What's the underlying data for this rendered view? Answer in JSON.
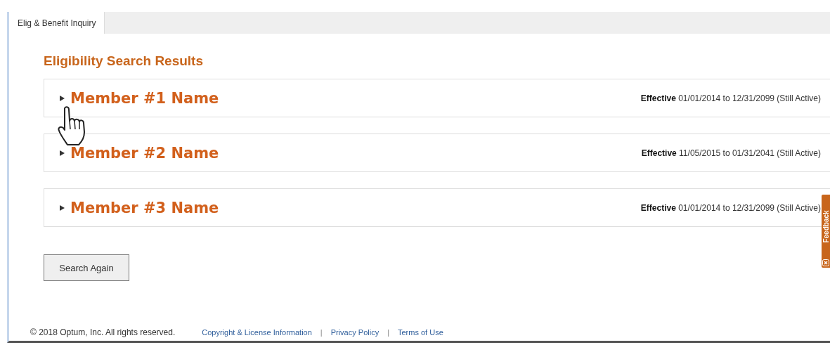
{
  "tabs": [
    {
      "label": "Elig & Benefit Inquiry",
      "selected": true
    }
  ],
  "heading": "Eligibility Search Results",
  "members": [
    {
      "name": "Member #1 Name",
      "expanded": false,
      "effective": "**Effective** 01/01/2014 to 12/31/2099 (Still Active)"
    },
    {
      "name": "Member #2 Name",
      "expanded": false,
      "effective": "**Effective** 11/05/2015 to 01/31/2041 (Still Active)"
    },
    {
      "name": "Member #3 Name",
      "expanded": false,
      "effective": "**Effective** 01/01/2014 to 12/31/2099 (Still Active)"
    }
  ],
  "search_again_button": "Search Again",
  "feedback_tab": "Feedback",
  "footer": {
    "copyright": "© 2018 Optum, Inc. All rights reserved.",
    "separator": "|",
    "links": [
      "Copyright & License Information",
      "Privacy Policy",
      "Terms of Use"
    ]
  }
}
